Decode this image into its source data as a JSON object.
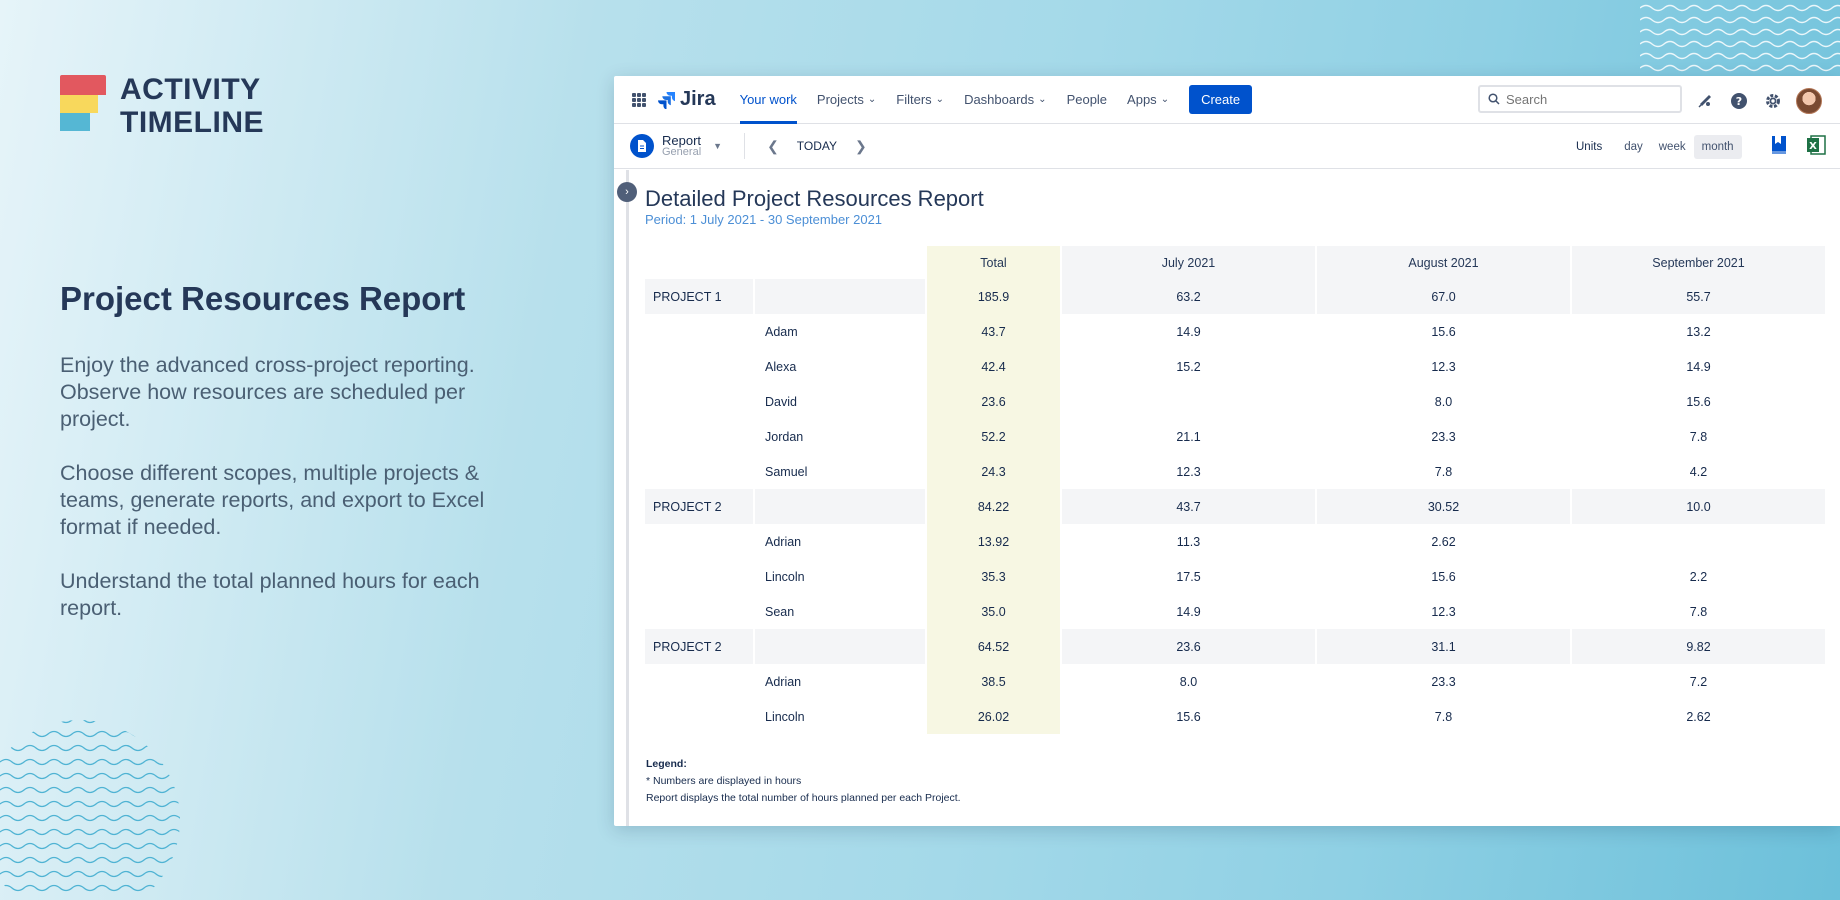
{
  "brand": {
    "logo_line1": "ACTIVITY",
    "logo_line2": "TIMELINE"
  },
  "marketing": {
    "title": "Project Resources Report",
    "paragraphs": [
      "Enjoy the advanced cross-project reporting. Observe how resources are scheduled per project.",
      "Choose different scopes, multiple projects & teams, generate reports, and export to Excel format if needed.",
      "Understand the total planned hours for each report."
    ]
  },
  "topbar": {
    "app_name": "Jira",
    "nav": [
      {
        "label": "Your work",
        "dropdown": false,
        "active": true
      },
      {
        "label": "Projects",
        "dropdown": true,
        "active": false
      },
      {
        "label": "Filters",
        "dropdown": true,
        "active": false
      },
      {
        "label": "Dashboards",
        "dropdown": true,
        "active": false
      },
      {
        "label": "People",
        "dropdown": false,
        "active": false
      },
      {
        "label": "Apps",
        "dropdown": true,
        "active": false
      }
    ],
    "create_label": "Create",
    "search_placeholder": "Search",
    "accent_color": "#0052cc"
  },
  "toolbar": {
    "report_name": "Report",
    "report_sub": "General",
    "today_label": "TODAY",
    "units_label": "Units",
    "unit_options": [
      "day",
      "week",
      "month"
    ],
    "unit_selected": "month"
  },
  "report": {
    "title": "Detailed Project Resources Report",
    "period": "Period: 1 July 2021 - 30 September 2021",
    "columns": [
      "Total",
      "July 2021",
      "August 2021",
      "September 2021"
    ],
    "rows": [
      {
        "type": "project",
        "name": "PROJECT 1",
        "values": [
          "185.9",
          "63.2",
          "67.0",
          "55.7"
        ]
      },
      {
        "type": "person",
        "name": "Adam",
        "values": [
          "43.7",
          "14.9",
          "15.6",
          "13.2"
        ]
      },
      {
        "type": "person",
        "name": "Alexa",
        "values": [
          "42.4",
          "15.2",
          "12.3",
          "14.9"
        ]
      },
      {
        "type": "person",
        "name": "David",
        "values": [
          "23.6",
          "",
          "8.0",
          "15.6"
        ]
      },
      {
        "type": "person",
        "name": "Jordan",
        "values": [
          "52.2",
          "21.1",
          "23.3",
          "7.8"
        ]
      },
      {
        "type": "person",
        "name": "Samuel",
        "values": [
          "24.3",
          "12.3",
          "7.8",
          "4.2"
        ]
      },
      {
        "type": "project",
        "name": "PROJECT 2",
        "values": [
          "84.22",
          "43.7",
          "30.52",
          "10.0"
        ]
      },
      {
        "type": "person",
        "name": "Adrian",
        "values": [
          "13.92",
          "11.3",
          "2.62",
          ""
        ]
      },
      {
        "type": "person",
        "name": "Lincoln",
        "values": [
          "35.3",
          "17.5",
          "15.6",
          "2.2"
        ]
      },
      {
        "type": "person",
        "name": "Sean",
        "values": [
          "35.0",
          "14.9",
          "12.3",
          "7.8"
        ]
      },
      {
        "type": "project",
        "name": "PROJECT 2",
        "values": [
          "64.52",
          "23.6",
          "31.1",
          "9.82"
        ]
      },
      {
        "type": "person",
        "name": "Adrian",
        "values": [
          "38.5",
          "8.0",
          "23.3",
          "7.2"
        ]
      },
      {
        "type": "person",
        "name": "Lincoln",
        "values": [
          "26.02",
          "15.6",
          "7.8",
          "2.62"
        ]
      }
    ],
    "legend_title": "Legend:",
    "legend_lines": [
      "* Numbers are displayed in hours",
      "Report displays the total number of hours planned per each Project."
    ]
  }
}
